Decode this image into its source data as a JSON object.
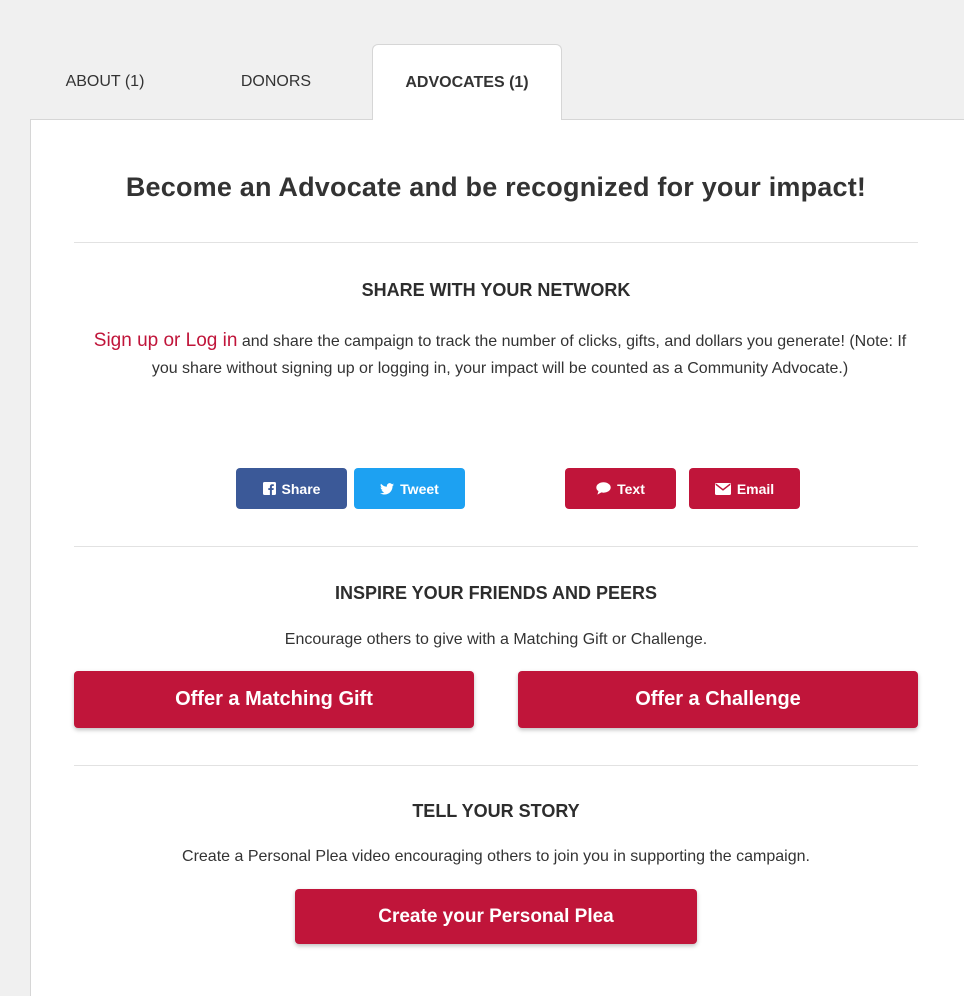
{
  "tabs": [
    {
      "label": "ABOUT (1)",
      "active": false
    },
    {
      "label": "DONORS",
      "active": false
    },
    {
      "label": "ADVOCATES (1)",
      "active": true
    }
  ],
  "headline": "Become an Advocate and be recognized for your impact!",
  "share": {
    "title": "SHARE WITH YOUR NETWORK",
    "login_link": "Sign up or Log in",
    "body": " and share the campaign to track the number of clicks, gifts, and dollars you generate! (Note: If you share without signing up or logging in, your impact will be counted as a Community Advocate.)",
    "buttons": {
      "facebook": {
        "label": "Share",
        "icon": "facebook-icon",
        "color": "#3b5998"
      },
      "twitter": {
        "label": "Tweet",
        "icon": "twitter-icon",
        "color": "#1da1f2"
      },
      "text": {
        "label": "Text",
        "icon": "chat-bubble-icon",
        "color": "#c0153a"
      },
      "email": {
        "label": "Email",
        "icon": "envelope-icon",
        "color": "#c0153a"
      }
    }
  },
  "inspire": {
    "title": "INSPIRE YOUR FRIENDS AND PEERS",
    "body": "Encourage others to give with a Matching Gift or Challenge.",
    "matching_label": "Offer a Matching Gift",
    "challenge_label": "Offer a Challenge"
  },
  "story": {
    "title": "TELL YOUR STORY",
    "body": "Create a Personal Plea video encouraging others to join you in supporting the campaign.",
    "plea_label": "Create your Personal Plea"
  },
  "colors": {
    "accent": "#c0153a",
    "facebook": "#3b5998",
    "twitter": "#1da1f2"
  }
}
